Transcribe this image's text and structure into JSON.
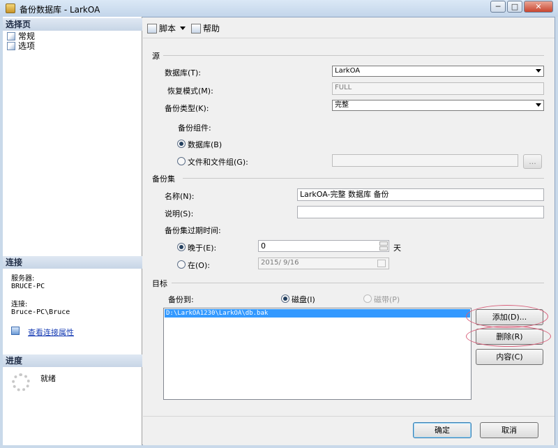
{
  "window": {
    "title": "备份数据库 - LarkOA",
    "min": "─",
    "max": "□",
    "close": "✕"
  },
  "left": {
    "select_page_header": "选择页",
    "nav": [
      {
        "label": "常规"
      },
      {
        "label": "选项"
      }
    ],
    "connection_header": "连接",
    "server_label": "服务器:",
    "server_value": "BRUCE-PC",
    "connection_label": "连接:",
    "connection_value": "Bruce-PC\\Bruce",
    "view_props_link": "查看连接属性",
    "progress_header": "进度",
    "progress_status": "就绪"
  },
  "toolbar": {
    "script_label": "脚本",
    "help_label": "帮助"
  },
  "source": {
    "group_title": "源",
    "database_label": "数据库(T):",
    "database_value": "LarkOA",
    "recovery_label": "恢复模式(M):",
    "recovery_value": "FULL",
    "backup_type_label": "备份类型(K):",
    "backup_type_value": "完整",
    "component_label": "备份组件:",
    "radio_database": "数据库(B)",
    "radio_files": "文件和文件组(G):",
    "browse_label": "..."
  },
  "backup_set": {
    "group_title": "备份集",
    "name_label": "名称(N):",
    "name_value": "LarkOA-完整 数据库 备份",
    "desc_label": "说明(S):",
    "desc_value": "",
    "expire_label": "备份集过期时间:",
    "after_label": "晚于(E):",
    "after_value": "0",
    "days_unit": "天",
    "on_label": "在(O):",
    "on_value": "2015/ 9/16"
  },
  "destination": {
    "group_title": "目标",
    "backup_to_label": "备份到:",
    "disk_label": "磁盘(I)",
    "tape_label": "磁带(P)",
    "paths": [
      "D:\\LarkOA1230\\LarkOA\\db.bak"
    ],
    "add_button": "添加(D)...",
    "remove_button": "删除(R)",
    "contents_button": "内容(C)"
  },
  "footer": {
    "ok_button": "确定",
    "cancel_button": "取消"
  },
  "colors": {
    "selection": "#3399ff",
    "highlight_ellipse": "#d85f7a",
    "link": "#1a3fb5"
  }
}
